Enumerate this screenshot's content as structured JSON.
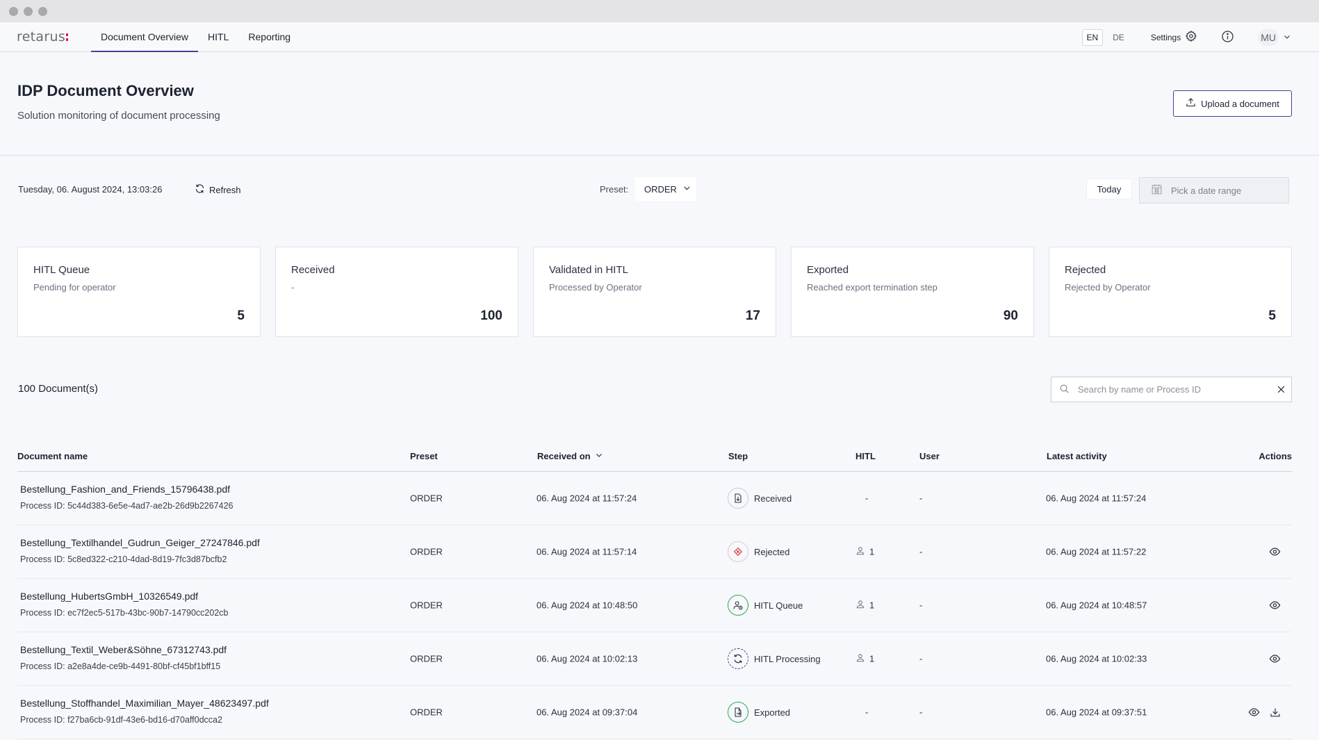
{
  "app": {
    "logo_text": "retarus",
    "nav": [
      "Document Overview",
      "HITL",
      "Reporting"
    ],
    "languages": [
      "EN",
      "DE"
    ],
    "settings_label": "Settings",
    "user_initials": "MU"
  },
  "header": {
    "title": "IDP Document Overview",
    "subtitle": "Solution monitoring of document processing",
    "upload_label": "Upload a document"
  },
  "toolbar": {
    "datetime": "Tuesday, 06. August 2024, 13:03:26",
    "refresh_label": "Refresh",
    "preset_label": "Preset:",
    "preset_value": "ORDER",
    "today_label": "Today",
    "date_range_placeholder": "Pick a date range"
  },
  "cards": [
    {
      "title": "HITL Queue",
      "subtitle": "Pending for operator",
      "count": "5"
    },
    {
      "title": "Received",
      "subtitle": "-",
      "count": "100"
    },
    {
      "title": "Validated in HITL",
      "subtitle": "Processed by Operator",
      "count": "17"
    },
    {
      "title": "Exported",
      "subtitle": "Reached export termination step",
      "count": "90"
    },
    {
      "title": "Rejected",
      "subtitle": "Rejected by Operator",
      "count": "5"
    }
  ],
  "documents": {
    "count_label": "100 Document(s)",
    "search_placeholder": "Search by name or Process ID",
    "columns": [
      "Document name",
      "Preset",
      "Received on",
      "Step",
      "HITL",
      "User",
      "Latest activity",
      "Actions"
    ],
    "rows": [
      {
        "name": "Bestellung_Fashion_and_Friends_15796438.pdf",
        "pid": "Process ID: 5c44d383-6e5e-4ad7-ae2b-26d9b2267426",
        "preset": "ORDER",
        "received": "06. Aug 2024 at 11:57:24",
        "step": "Received",
        "step_icon": "received-icon",
        "hitl": "-",
        "user": "-",
        "latest": "06. Aug 2024 at 11:57:24",
        "actions": []
      },
      {
        "name": "Bestellung_Textilhandel_Gudrun_Geiger_27247846.pdf",
        "pid": "Process ID: 5c8ed322-c210-4dad-8d19-7fc3d87bcfb2",
        "preset": "ORDER",
        "received": "06. Aug 2024 at 11:57:14",
        "step": "Rejected",
        "step_icon": "rejected-icon",
        "hitl": "1",
        "user": "-",
        "latest": "06. Aug 2024 at 11:57:22",
        "actions": [
          "view"
        ]
      },
      {
        "name": "Bestellung_HubertsGmbH_10326549.pdf",
        "pid": "Process ID: ec7f2ec5-517b-43bc-90b7-14790cc202cb",
        "preset": "ORDER",
        "received": "06. Aug 2024 at 10:48:50",
        "step": "HITL Queue",
        "step_icon": "hitl-queue-icon",
        "hitl": "1",
        "user": "-",
        "latest": "06. Aug 2024 at 10:48:57",
        "actions": [
          "view"
        ]
      },
      {
        "name": "Bestellung_Textil_Weber&Söhne_67312743.pdf",
        "pid": "Process ID: a2e8a4de-ce9b-4491-80bf-cf45bf1bff15",
        "preset": "ORDER",
        "received": "06. Aug 2024 at 10:02:13",
        "step": "HITL Processing",
        "step_icon": "hitl-processing-icon",
        "hitl": "1",
        "user": "-",
        "latest": "06. Aug 2024 at 10:02:33",
        "actions": [
          "view"
        ]
      },
      {
        "name": "Bestellung_Stoffhandel_Maximilian_Mayer_48623497.pdf",
        "pid": "Process ID: f27ba6cb-91df-43e6-bd16-d70aff0dcca2",
        "preset": "ORDER",
        "received": "06. Aug 2024 at 09:37:04",
        "step": "Exported",
        "step_icon": "exported-icon",
        "hitl": "-",
        "user": "-",
        "latest": "06. Aug 2024 at 09:37:51",
        "actions": [
          "view",
          "download"
        ]
      }
    ]
  },
  "colors": {
    "accent": "#4a3d94",
    "brand": "#e3004f",
    "success": "#2fa84f",
    "danger": "#d93a3a"
  }
}
